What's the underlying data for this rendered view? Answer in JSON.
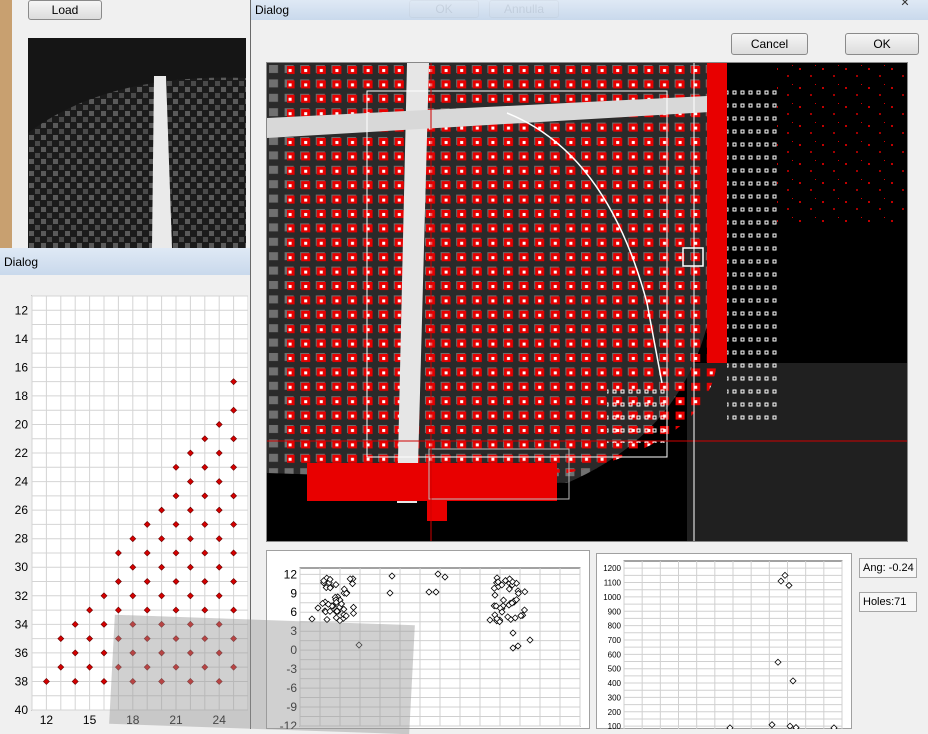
{
  "back_window": {
    "load_label": "Load",
    "dialog_title": "Dialog",
    "chart_data": {
      "type": "scatter",
      "title": "",
      "xlabel": "",
      "ylabel": "",
      "x_ticks": [
        "12",
        "15",
        "18",
        "21",
        "24"
      ],
      "y_ticks": [
        "12",
        "14",
        "16",
        "18",
        "20",
        "22",
        "24",
        "26",
        "28",
        "30",
        "32",
        "34",
        "36",
        "38",
        "40"
      ],
      "xlim": [
        11,
        26
      ],
      "ylim": [
        11,
        40
      ],
      "y_inverted": true,
      "grid": true,
      "marker_color": "#d40000",
      "points_desc": "triangular lattice of holes: x from 11 to 25 step 1, y from 17 to 38 step 1"
    }
  },
  "main_dialog": {
    "title": "Dialog",
    "close_glyph": "✕",
    "cancel_label": "Cancel",
    "ok_label": "OK",
    "hidden_btn1": "OK",
    "hidden_btn2": "Annulla",
    "ang_label": "Ang: -0.24",
    "holes_label": "Holes:71",
    "chart_left": {
      "type": "scatter",
      "y_ticks": [
        "12",
        "9",
        "6",
        "3",
        "0",
        "-3",
        "-6",
        "-9",
        "-12"
      ],
      "ylim": [
        -12,
        13
      ],
      "grid": true,
      "marker": "diamond-open"
    },
    "chart_right": {
      "type": "scatter",
      "y_ticks": [
        "1200",
        "1100",
        "1000",
        "900",
        "800",
        "700",
        "600",
        "500",
        "400",
        "300",
        "200",
        "100"
      ],
      "ylim": [
        80,
        1250
      ],
      "grid": true,
      "marker": "diamond-open"
    }
  }
}
